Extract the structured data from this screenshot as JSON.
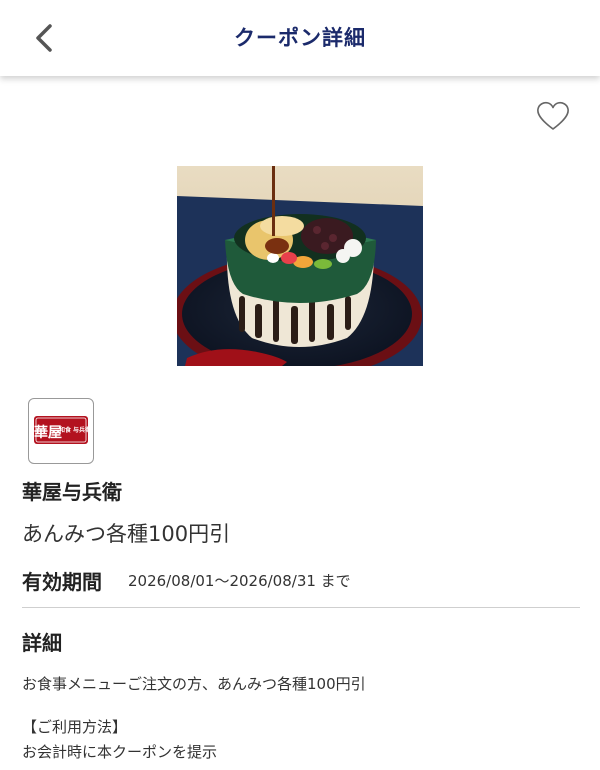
{
  "header": {
    "title": "クーポン詳細",
    "back_icon": "chevron-left-icon"
  },
  "favorite": {
    "icon": "heart-outline-icon"
  },
  "store": {
    "logo_text": "華屋",
    "logo_subtext": "和食 与兵衛",
    "logo_color": "#b3121f",
    "name": "華屋与兵衛"
  },
  "coupon": {
    "title": "あんみつ各種100円引",
    "valid_label": "有効期間",
    "valid_period": "2026/08/01～2026/08/31 まで"
  },
  "detail": {
    "label": "詳細",
    "text": "お食事メニューご注文の方、あんみつ各種100円引",
    "usage_heading": "【ご利用方法】",
    "usage_text": "お会計時に本クーポンを提示"
  },
  "colors": {
    "title_navy": "#1b2a6b",
    "bowl_green": "#1f5a3a"
  }
}
